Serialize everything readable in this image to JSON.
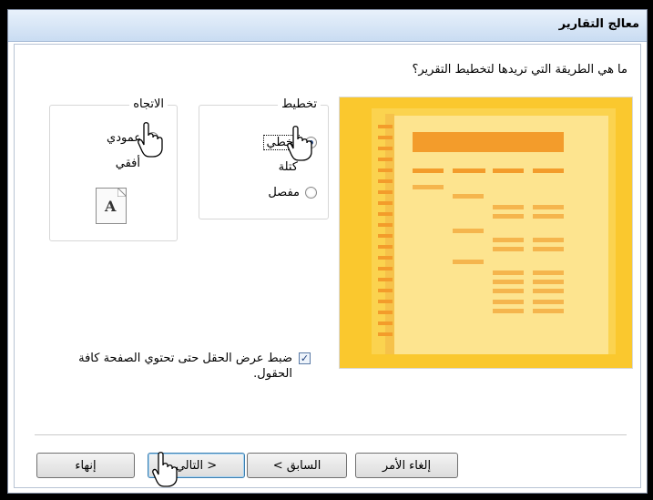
{
  "dialog": {
    "title": "معالج التقارير",
    "question": "ما هي الطريقة التي تريدها لتخطيط التقرير؟"
  },
  "layout_group": {
    "title": "تخطيط",
    "options": [
      {
        "label": "تخطي",
        "selected": true
      },
      {
        "label": "كتلة",
        "selected": false
      },
      {
        "label": "مفصل",
        "selected": false
      }
    ]
  },
  "orientation_group": {
    "title": "الاتجاه",
    "options": [
      {
        "label": "عمودي",
        "selected": true
      },
      {
        "label": "أفقي",
        "selected": false
      }
    ],
    "page_icon_letter": "A"
  },
  "fit_checkbox": {
    "checked": true,
    "label": "ضبط عرض الحقل حتى تحتوي الصفحة كافة الحقول."
  },
  "buttons": {
    "cancel": "إلغاء الأمر",
    "back": "< السابق",
    "next": "التالي >",
    "finish": "إنهاء"
  },
  "colors": {
    "preview_bg": "#fac82e",
    "preview_page": "#fde48f",
    "preview_header": "#f39c2b"
  }
}
